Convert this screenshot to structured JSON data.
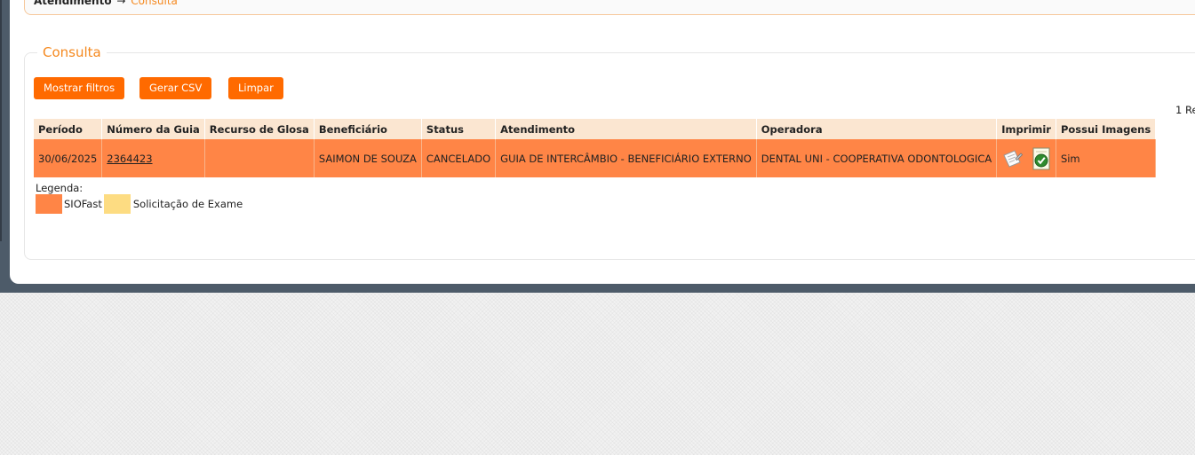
{
  "breadcrumb": {
    "root": "Atendimento",
    "arrow": "→",
    "current": "Consulta"
  },
  "section_title": "Consulta",
  "buttons": {
    "show_filters": "Mostrar filtros",
    "generate_csv": "Gerar CSV",
    "clear": "Limpar"
  },
  "record_count": "1 Re",
  "table": {
    "headers": [
      "Período",
      "Número da Guia",
      "Recurso de Glosa",
      "Beneficiário",
      "Status",
      "Atendimento",
      "Operadora",
      "Imprimir",
      "Possui Imagens"
    ],
    "rows": [
      {
        "periodo": "30/06/2025",
        "numero_guia": "2364423",
        "recurso_glosa": "",
        "beneficiario": "SAIMON DE SOUZA",
        "status": "CANCELADO",
        "atendimento": "GUIA DE INTERCÂMBIO - BENEFICIÁRIO EXTERNO",
        "operadora": "DENTAL UNI - COOPERATIVA ODONTOLOGICA",
        "imprimir_icons": [
          "print-document-icon",
          "approved-document-icon"
        ],
        "possui_imagens": "Sim"
      }
    ]
  },
  "legend": {
    "label": "Legenda:",
    "items": [
      {
        "text": "SIOFast",
        "color": "#ff8546"
      },
      {
        "text": "Solicitação de Exame",
        "color": "#fddc82"
      }
    ]
  },
  "colors": {
    "accent": "#ff6a00",
    "title": "#f5891f",
    "header_bg": "#fbe6d1",
    "row_bg": "#ff8546"
  }
}
